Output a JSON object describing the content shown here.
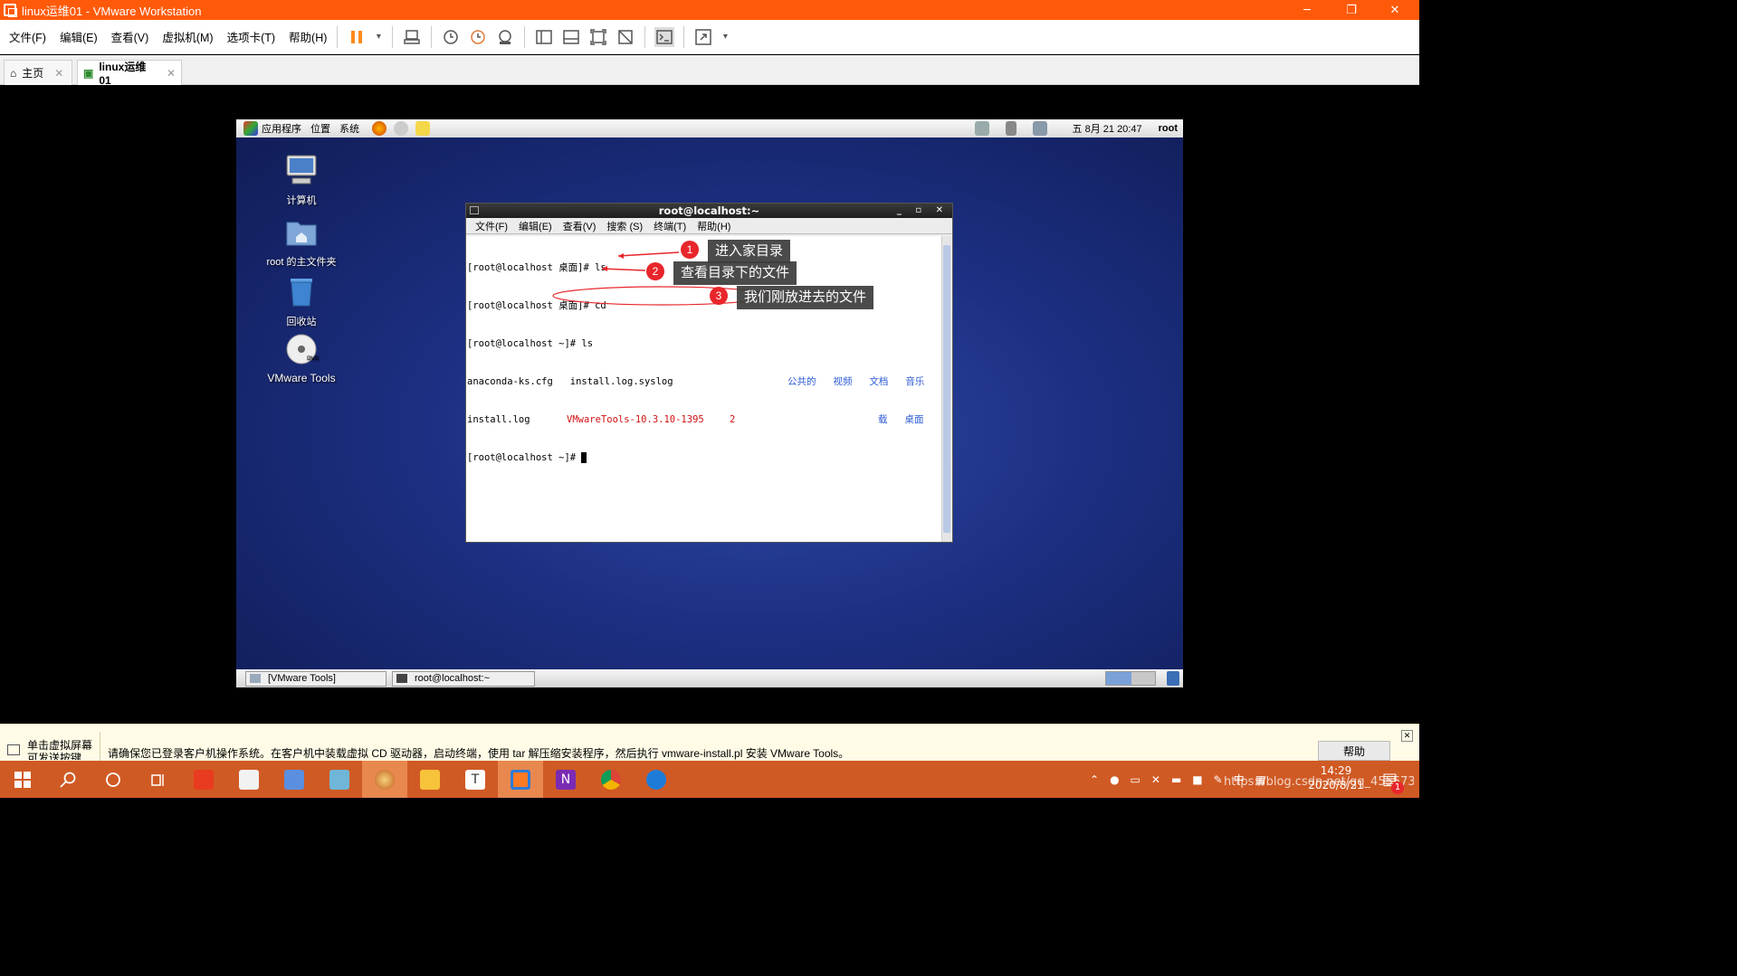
{
  "window": {
    "title": "linux运维01 - VMware Workstation",
    "minimize": "─",
    "restore": "❐",
    "close": "✕"
  },
  "menu": [
    "文件(F)",
    "编辑(E)",
    "查看(V)",
    "虚拟机(M)",
    "选项卡(T)",
    "帮助(H)"
  ],
  "tabs": [
    {
      "label": "主页",
      "close": "✕"
    },
    {
      "label": "linux运维01",
      "close": "✕"
    }
  ],
  "guest": {
    "panel": {
      "apps": "应用程序",
      "places": "位置",
      "system": "系统",
      "clock": "五 8月 21 20:47",
      "user": "root"
    },
    "desktop_icons": [
      "计算机",
      "root 的主文件夹",
      "回收站",
      "VMware Tools"
    ],
    "dvd_label": "DVD",
    "terminal": {
      "title": "root@localhost:~",
      "menu": [
        "文件(F)",
        "编辑(E)",
        "查看(V)",
        "搜索 (S)",
        "终端(T)",
        "帮助(H)"
      ],
      "line1": "[root@localhost 桌面]# ls",
      "line2": "[root@localhost 桌面]# cd",
      "line3": "[root@localhost ~]# ls",
      "line4a": "anaconda-ks.cfg   install.log.syslog",
      "line4b": "公共的   视频   文档   音乐",
      "line5a": "install.log",
      "line5red": "VMwareTools-10.3.10-1395",
      "line5b": "2",
      "line5c": "载   桌面",
      "line6": "[root@localhost ~]# "
    },
    "callouts": [
      {
        "num": "1",
        "text": "进入家目录"
      },
      {
        "num": "2",
        "text": "查看目录下的文件"
      },
      {
        "num": "3",
        "text": "我们刚放进去的文件"
      }
    ],
    "taskbar": [
      "[VMware Tools]",
      "root@localhost:~"
    ]
  },
  "infobar": {
    "left_line1": "单击虚拟屏幕",
    "left_line2": "可发送按键",
    "message": "请确保您已登录客户机操作系统。在客户机中装载虚拟 CD 驱动器，启动终端，使用 tar 解压缩安装程序，然后执行 vmware-install.pl 安装 VMware Tools。",
    "help_button": "帮助",
    "close": "✕"
  },
  "win_taskbar": {
    "time": "14:29",
    "date": "2020/8/21",
    "ime": "中",
    "watermark": "https://blog.csdn.net/qq_45557389",
    "notify_count": "1"
  }
}
